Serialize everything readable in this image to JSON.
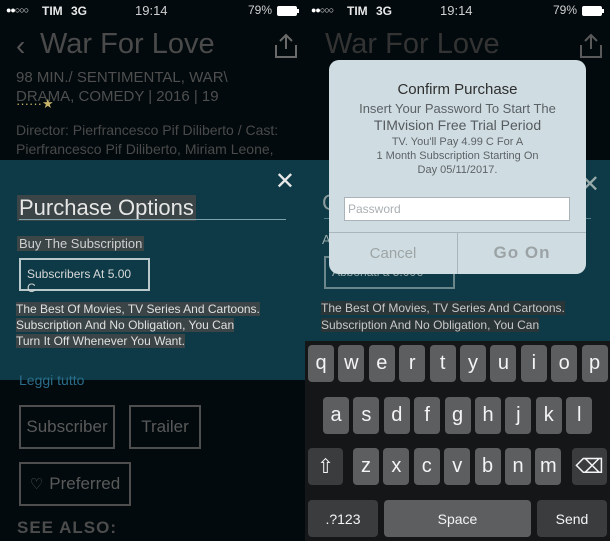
{
  "status_bar": {
    "signal": "●●○○○",
    "carrier": "TIM",
    "network": "3G",
    "time": "19:14",
    "battery_pct": "79%"
  },
  "movie": {
    "title": "War For Love",
    "meta_line1": "98 MIN./ SENTIMENTAL, WAR\\",
    "meta_line2": "DRAMA, COMEDY | 2016 | 19",
    "stars": "······★",
    "director_line1": "Director: Pierfrancesco Pif Diliberto / Cast:",
    "director_line2": "Pierfrancesco Pif Diliberto, Miriam Leone,",
    "read_more": "Leggi tutto",
    "buttons": {
      "subscriber": "Subscriber",
      "trailer": "Trailer",
      "preferred": "Preferred"
    },
    "see_also": "SEE ALSO:"
  },
  "purchase_sheet": {
    "heading": "Purchase Options",
    "subheading": "Buy The Subscription",
    "select_value": "Subscribers At 5.00 C",
    "desc_line1": "The Best Of Movies, TV Series And Cartoons.",
    "desc_line2": "Subscription And No Obligation, You Can",
    "desc_line3": "Turn It Off Whenever You Want.",
    "right_select_value": "Abbonati a 5.00€",
    "heading_initial": "C",
    "subheading_initial": "A"
  },
  "confirm_dialog": {
    "title": "Confirm Purchase",
    "msg_line1": "Insert Your Password To Start The",
    "msg_line2": "TIMvision Free Trial Period",
    "msg_line3": "TV. You'll Pay 4.99 C For A",
    "msg_line4": "1 Month Subscription Starting On",
    "msg_line5": "Day 05/11/2017.",
    "password_placeholder": "Password",
    "cancel_label": "Cancel",
    "confirm_label": "Go On"
  },
  "keyboard": {
    "row1": [
      "q",
      "w",
      "e",
      "r",
      "t",
      "y",
      "u",
      "i",
      "o",
      "p"
    ],
    "row2": [
      "a",
      "s",
      "d",
      "f",
      "g",
      "h",
      "j",
      "k",
      "l"
    ],
    "row3": [
      "z",
      "x",
      "c",
      "v",
      "b",
      "n",
      "m"
    ],
    "shift": "⇧",
    "backspace": "⌫",
    "numbers": ".?123",
    "space": "Space",
    "send": "Send"
  }
}
